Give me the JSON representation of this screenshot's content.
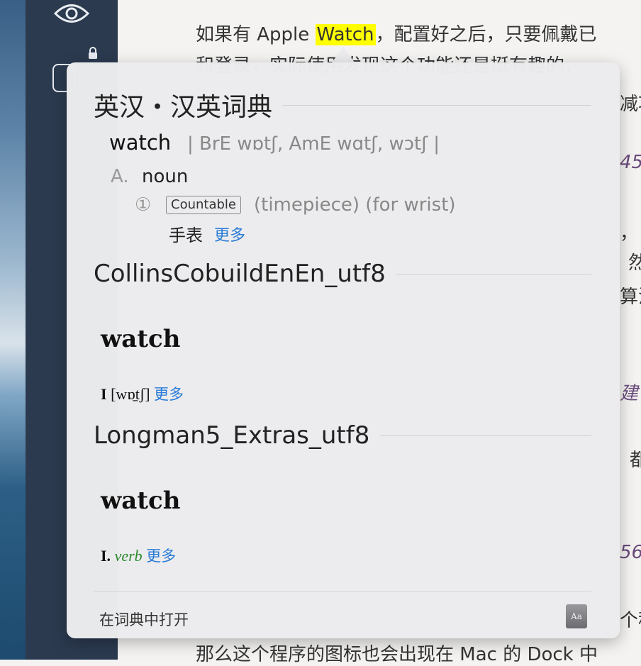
{
  "article": {
    "line1_before": "如果有 Apple ",
    "line1_highlight": "Watch",
    "line1_after": "，配置好之后，只要佩戴已",
    "line2": "和登录，实际使用发现这个功能还是挺有趣的，",
    "right_fragments": [
      "减功",
      "45",
      "，",
      "然",
      "算法",
      "建议",
      "都",
      "56",
      "个程"
    ],
    "bottom_line": "那么这个程序的图标也会出现在 Mac 的 Dock 中"
  },
  "popover": {
    "sections": [
      {
        "title": "英汉・汉英词典",
        "headword": "watch",
        "pron": "| BrE wɒtʃ,  AmE wɑtʃ, wɔtʃ |",
        "pos_letter": "A.",
        "pos": "noun",
        "sense_num": "①",
        "tag": "Countable",
        "gloss": "(timepiece)  (for wrist)",
        "translation": "手表",
        "more": "更多"
      },
      {
        "title": "CollinsCobuildEnEn_utf8",
        "headword": "watch",
        "roman": "I",
        "pron": "[wɒ̱tʃ]",
        "more": "更多"
      },
      {
        "title": "Longman5_Extras_utf8",
        "headword": "watch",
        "roman": "I.",
        "pos": "verb",
        "more": "更多"
      }
    ],
    "footer": {
      "open_label": "在词典中打开",
      "icon_label": "Aa"
    }
  },
  "colors": {
    "highlight": "#ffff00",
    "link": "#2a7bd6",
    "sidebar": "#2b3a4f",
    "verb_green": "#2b8a2b"
  },
  "icons": {
    "sidebar_top": "eye-icon",
    "sidebar_lock": "lock-icon",
    "dictionary": "dictionary-book-icon"
  }
}
